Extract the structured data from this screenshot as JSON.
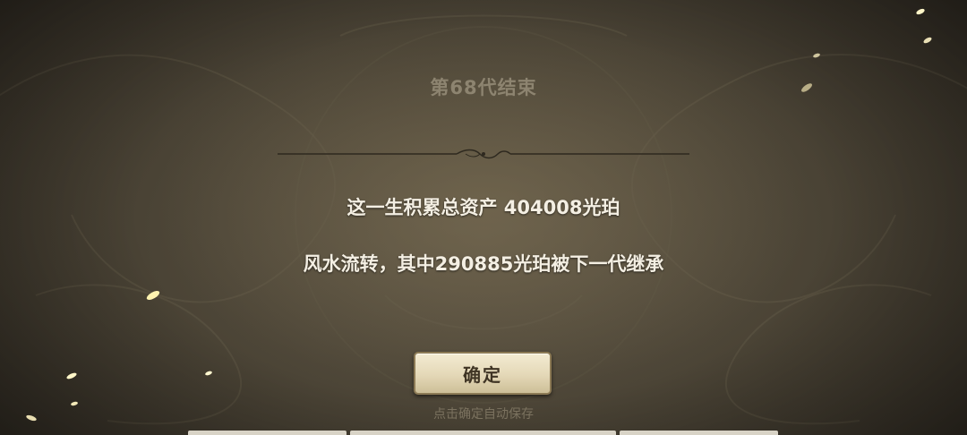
{
  "dialog": {
    "title": "第68代结束",
    "total_assets_line": "这一生积累总资产 404008光珀",
    "inheritance_line": "风水流转，其中290885光珀被下一代继承",
    "confirm_label": "确定",
    "hint": "点击确定自动保存"
  },
  "colors": {
    "background": "#4a4335",
    "title": "#8d8470",
    "body_text": "#f4efe3",
    "button_face": "#e4d8b7",
    "button_text": "#3f3424",
    "hint": "#7b725f"
  }
}
